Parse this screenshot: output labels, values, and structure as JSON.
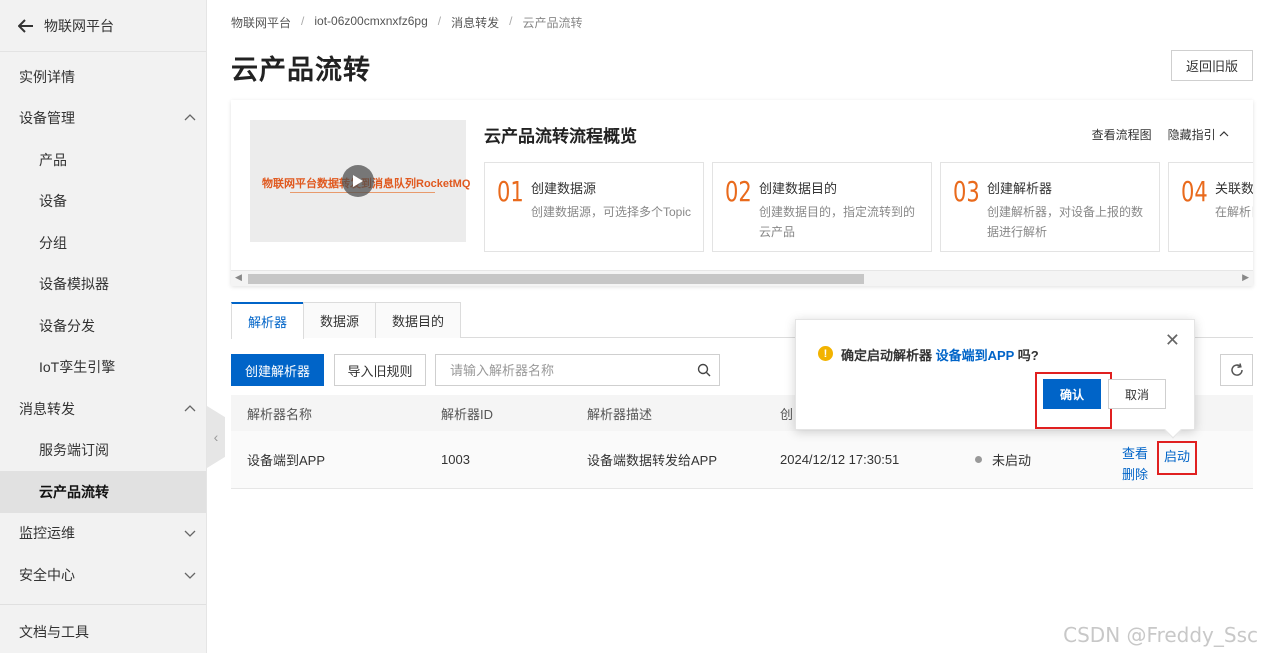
{
  "sidebar": {
    "title": "物联网平台",
    "items": [
      {
        "label": "实例详情",
        "type": "top"
      },
      {
        "label": "设备管理",
        "type": "group",
        "expanded": true
      },
      {
        "label": "产品",
        "type": "sub"
      },
      {
        "label": "设备",
        "type": "sub"
      },
      {
        "label": "分组",
        "type": "sub"
      },
      {
        "label": "设备模拟器",
        "type": "sub"
      },
      {
        "label": "设备分发",
        "type": "sub"
      },
      {
        "label": "IoT孪生引擎",
        "type": "sub"
      },
      {
        "label": "消息转发",
        "type": "group",
        "expanded": true
      },
      {
        "label": "服务端订阅",
        "type": "sub"
      },
      {
        "label": "云产品流转",
        "type": "sub",
        "active": true
      },
      {
        "label": "监控运维",
        "type": "group",
        "expanded": false
      },
      {
        "label": "安全中心",
        "type": "group",
        "expanded": false
      }
    ],
    "footer": "文档与工具"
  },
  "breadcrumb": [
    "物联网平台",
    "iot-06z00cmxnxfz6pg",
    "消息转发",
    "云产品流转"
  ],
  "page_title": "云产品流转",
  "legacy_button": "返回旧版",
  "guide": {
    "video_text": "物联网平台数据转发到消息队列RocketMQ",
    "title": "云产品流转流程概览",
    "view_flow": "查看流程图",
    "hide_guide": "隐藏指引",
    "steps": [
      {
        "num": "01",
        "title": "创建数据源",
        "desc": "创建数据源，可选择多个Topic"
      },
      {
        "num": "02",
        "title": "创建数据目的",
        "desc": "创建数据目的，指定流转到的云产品"
      },
      {
        "num": "03",
        "title": "创建解析器",
        "desc": "创建解析器，对设备上报的数据进行解析"
      },
      {
        "num": "04",
        "title": "关联数",
        "desc": "在解析目的"
      }
    ]
  },
  "tabs": [
    {
      "label": "解析器",
      "active": true
    },
    {
      "label": "数据源",
      "active": false
    },
    {
      "label": "数据目的",
      "active": false
    }
  ],
  "toolbar": {
    "create_label": "创建解析器",
    "import_label": "导入旧规则",
    "search_placeholder": "请输入解析器名称"
  },
  "table": {
    "headers": {
      "name": "解析器名称",
      "id": "解析器ID",
      "desc": "解析器描述",
      "created": "创"
    },
    "rows": [
      {
        "name": "设备端到APP",
        "id": "1003",
        "desc": "设备端数据转发给APP",
        "created": "2024/12/12 17:30:51",
        "status": "未启动",
        "ops": {
          "view": "查看",
          "delete": "删除",
          "start": "启动"
        }
      }
    ]
  },
  "popconfirm": {
    "prefix": "确定启动解析器 ",
    "target": "设备端到APP",
    "suffix": " 吗?",
    "confirm": "确认",
    "cancel": "取消"
  },
  "watermark": "CSDN @Freddy_Ssc",
  "colors": {
    "primary": "#0064c8",
    "accent_orange": "#e96a1c",
    "highlight_red": "#e02020",
    "warning": "#f2b300"
  }
}
